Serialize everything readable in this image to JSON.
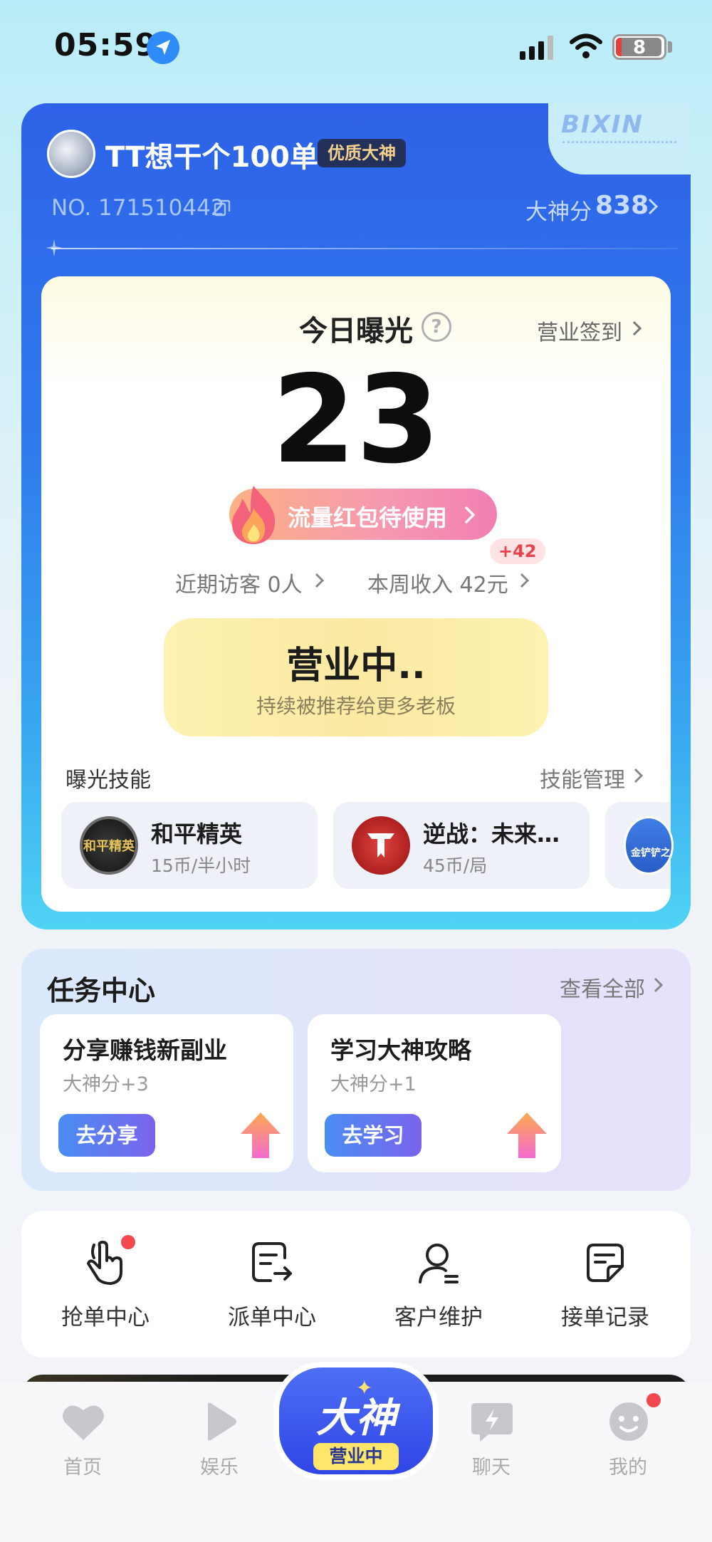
{
  "status_bar": {
    "time": "05:59",
    "battery": "8"
  },
  "brand": {
    "logo": "BIXIN"
  },
  "profile": {
    "username": "TT想干个100单",
    "badge": "优质大神",
    "user_no": "NO. 171510442",
    "score_label": "大神分",
    "score_value": "838"
  },
  "exposure": {
    "title": "今日曝光",
    "help": "?",
    "checkin": "营业签到",
    "count": "23",
    "redpack": "流量红包待使用",
    "plus_badge": "+42",
    "visitors": "近期访客 0人",
    "income": "本周收入 42元",
    "business_title": "营业中..",
    "business_sub": "持续被推荐给更多老板"
  },
  "skills": {
    "label": "曝光技能",
    "manage": "技能管理",
    "items": [
      {
        "name": "和平精英",
        "price": "15币/半小时",
        "icon_text": "和平精英"
      },
      {
        "name": "逆战：未来…",
        "price": "45币/局"
      },
      {
        "name": "",
        "icon_text": "金铲铲之"
      }
    ]
  },
  "tasks": {
    "title": "任务中心",
    "view_all": "查看全部",
    "items": [
      {
        "name": "分享赚钱新副业",
        "reward": "大神分+3",
        "button": "去分享"
      },
      {
        "name": "学习大神攻略",
        "reward": "大神分+1",
        "button": "去学习"
      }
    ]
  },
  "tools": [
    {
      "label": "抢单中心",
      "icon": "tap-hand-icon"
    },
    {
      "label": "派单中心",
      "icon": "dispatch-icon"
    },
    {
      "label": "客户维护",
      "icon": "customer-icon"
    },
    {
      "label": "接单记录",
      "icon": "record-icon"
    }
  ],
  "nav": {
    "home": "首页",
    "entertainment": "娱乐",
    "center_title": "大神",
    "center_status": "营业中",
    "chat": "聊天",
    "me": "我的"
  },
  "colors": {
    "card_blue": "#2e62e8",
    "accent_purple": "#7a63ec",
    "business_yellow": "#fdf2b2",
    "alert_red": "#f2474f"
  }
}
